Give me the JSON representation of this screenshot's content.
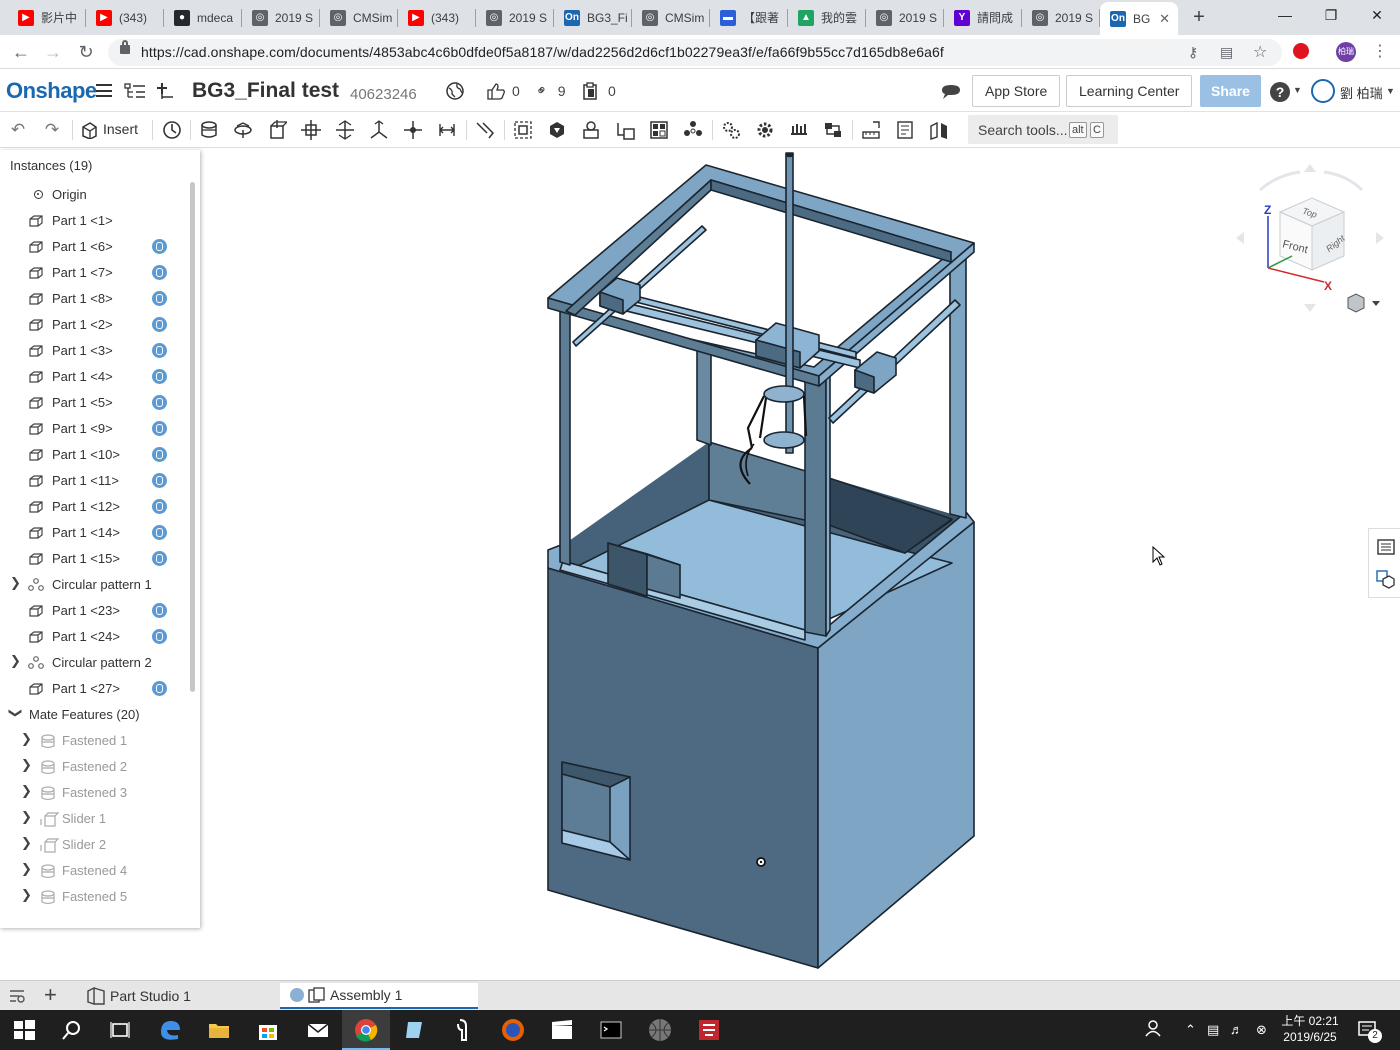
{
  "browser": {
    "tabs": [
      {
        "label": "影片中",
        "icon": "youtube-icon",
        "color": "#ff0000"
      },
      {
        "label": "(343) ",
        "icon": "youtube-icon",
        "color": "#ff0000"
      },
      {
        "label": "mdeca",
        "icon": "github-icon",
        "color": "#24292e"
      },
      {
        "label": "2019 S",
        "icon": "globe-icon",
        "color": "#5f6368"
      },
      {
        "label": "CMSim",
        "icon": "globe-icon",
        "color": "#5f6368"
      },
      {
        "label": "(343) ",
        "icon": "youtube-icon",
        "color": "#ff0000"
      },
      {
        "label": "2019 S",
        "icon": "globe-icon",
        "color": "#5f6368"
      },
      {
        "label": "BG3_Fi",
        "icon": "onshape-icon",
        "color": "#1b68b0"
      },
      {
        "label": "CMSim",
        "icon": "globe-icon",
        "color": "#5f6368"
      },
      {
        "label": "【跟著",
        "icon": "chat-icon",
        "color": "#2b5fd9"
      },
      {
        "label": "我的雲",
        "icon": "drive-icon",
        "color": "#1fa463"
      },
      {
        "label": "2019 S",
        "icon": "globe-icon",
        "color": "#5f6368"
      },
      {
        "label": "請問成",
        "icon": "yahoo-icon",
        "color": "#5f01d1"
      },
      {
        "label": "2019 S",
        "icon": "globe-icon",
        "color": "#5f6368"
      },
      {
        "label": "BG",
        "icon": "onshape-icon",
        "color": "#1b68b0",
        "active": true
      }
    ],
    "url": "https://cad.onshape.com/documents/4853abc4c6b0dfde0f5a8187/w/dad2256d2d6cf1b02279ea3f/e/fa66f9b55cc7d165db8e6a6f",
    "profile_label": "柏瑞"
  },
  "onshape": {
    "logo": "Onshape",
    "doc_title": "BG3_Final test",
    "doc_number": "40623246",
    "likes": "0",
    "links": "9",
    "copies": "0",
    "app_store": "App Store",
    "learning_center": "Learning Center",
    "share": "Share",
    "help": "?",
    "user_name": "劉 柏瑞",
    "insert_label": "Insert",
    "search_tools": "Search tools...",
    "search_key1": "alt",
    "search_key2": "C"
  },
  "panel": {
    "title": "Instances (19)",
    "origin": "Origin",
    "instances": [
      {
        "label": "Part 1 <1>",
        "mated": false
      },
      {
        "label": "Part 1 <6>",
        "mated": true
      },
      {
        "label": "Part 1 <7>",
        "mated": true
      },
      {
        "label": "Part 1 <8>",
        "mated": true
      },
      {
        "label": "Part 1 <2>",
        "mated": true
      },
      {
        "label": "Part 1 <3>",
        "mated": true
      },
      {
        "label": "Part 1 <4>",
        "mated": true
      },
      {
        "label": "Part 1 <5>",
        "mated": true
      },
      {
        "label": "Part 1 <9>",
        "mated": true
      },
      {
        "label": "Part 1 <10>",
        "mated": true
      },
      {
        "label": "Part 1 <11>",
        "mated": true
      },
      {
        "label": "Part 1 <12>",
        "mated": true
      },
      {
        "label": "Part 1 <14>",
        "mated": true
      },
      {
        "label": "Part 1 <15>",
        "mated": true
      },
      {
        "label": "Circular pattern 1",
        "pattern": true
      },
      {
        "label": "Part 1 <23>",
        "mated": true
      },
      {
        "label": "Part 1 <24>",
        "mated": true
      },
      {
        "label": "Circular pattern 2",
        "pattern": true
      },
      {
        "label": "Part 1 <27>",
        "mated": true
      }
    ],
    "mate_header": "Mate Features (20)",
    "mates": [
      {
        "label": "Fastened 1",
        "type": "fastened"
      },
      {
        "label": "Fastened 2",
        "type": "fastened"
      },
      {
        "label": "Fastened 3",
        "type": "fastened"
      },
      {
        "label": "Slider 1",
        "type": "slider"
      },
      {
        "label": "Slider 2",
        "type": "slider"
      },
      {
        "label": "Fastened 4",
        "type": "fastened"
      },
      {
        "label": "Fastened 5",
        "type": "fastened"
      }
    ]
  },
  "viewcube": {
    "top": "Top",
    "front": "Front",
    "right": "Right",
    "axis_x": "X",
    "axis_z": "Z"
  },
  "bottom_tabs": [
    {
      "label": "Part Studio 1",
      "active": false
    },
    {
      "label": "Assembly 1",
      "active": true
    }
  ],
  "clock": {
    "time": "上午 02:21",
    "date": "2019/6/25"
  },
  "notifications": "2",
  "colors": {
    "model_light": "#8fb3cf",
    "model_mid": "#6f94b2",
    "model_dark": "#4e6a82",
    "accent": "#1b68b0"
  }
}
